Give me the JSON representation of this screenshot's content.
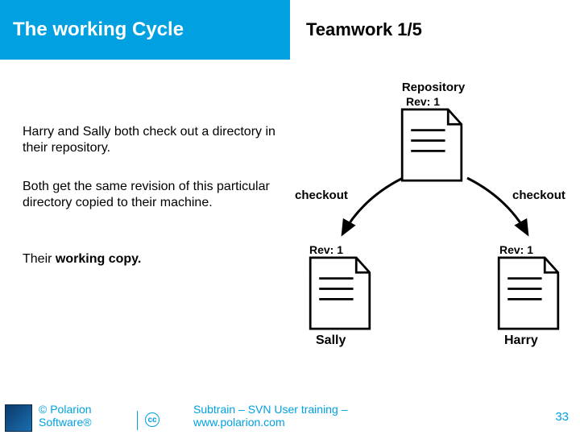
{
  "header": {
    "title": "The working Cycle"
  },
  "subtitle": "Teamwork 1/5",
  "paragraphs": {
    "p1": "Harry and Sally both check out a directory in their repository.",
    "p2": "Both get the same revision of this particular directory copied to their machine.",
    "p3_prefix": "Their ",
    "p3_bold": "working copy."
  },
  "diagram": {
    "repo_label": "Repository",
    "repo_rev": "Rev: 1",
    "checkout_left": "checkout",
    "checkout_right": "checkout",
    "left_rev": "Rev: 1",
    "right_rev": "Rev: 1",
    "left_name": "Sally",
    "right_name": "Harry"
  },
  "footer": {
    "copyright_line1": "© Polarion",
    "copyright_line2": "Software®",
    "center_line1": "Subtrain – SVN User training –",
    "center_line2": "www.polarion.com",
    "page": "33"
  }
}
